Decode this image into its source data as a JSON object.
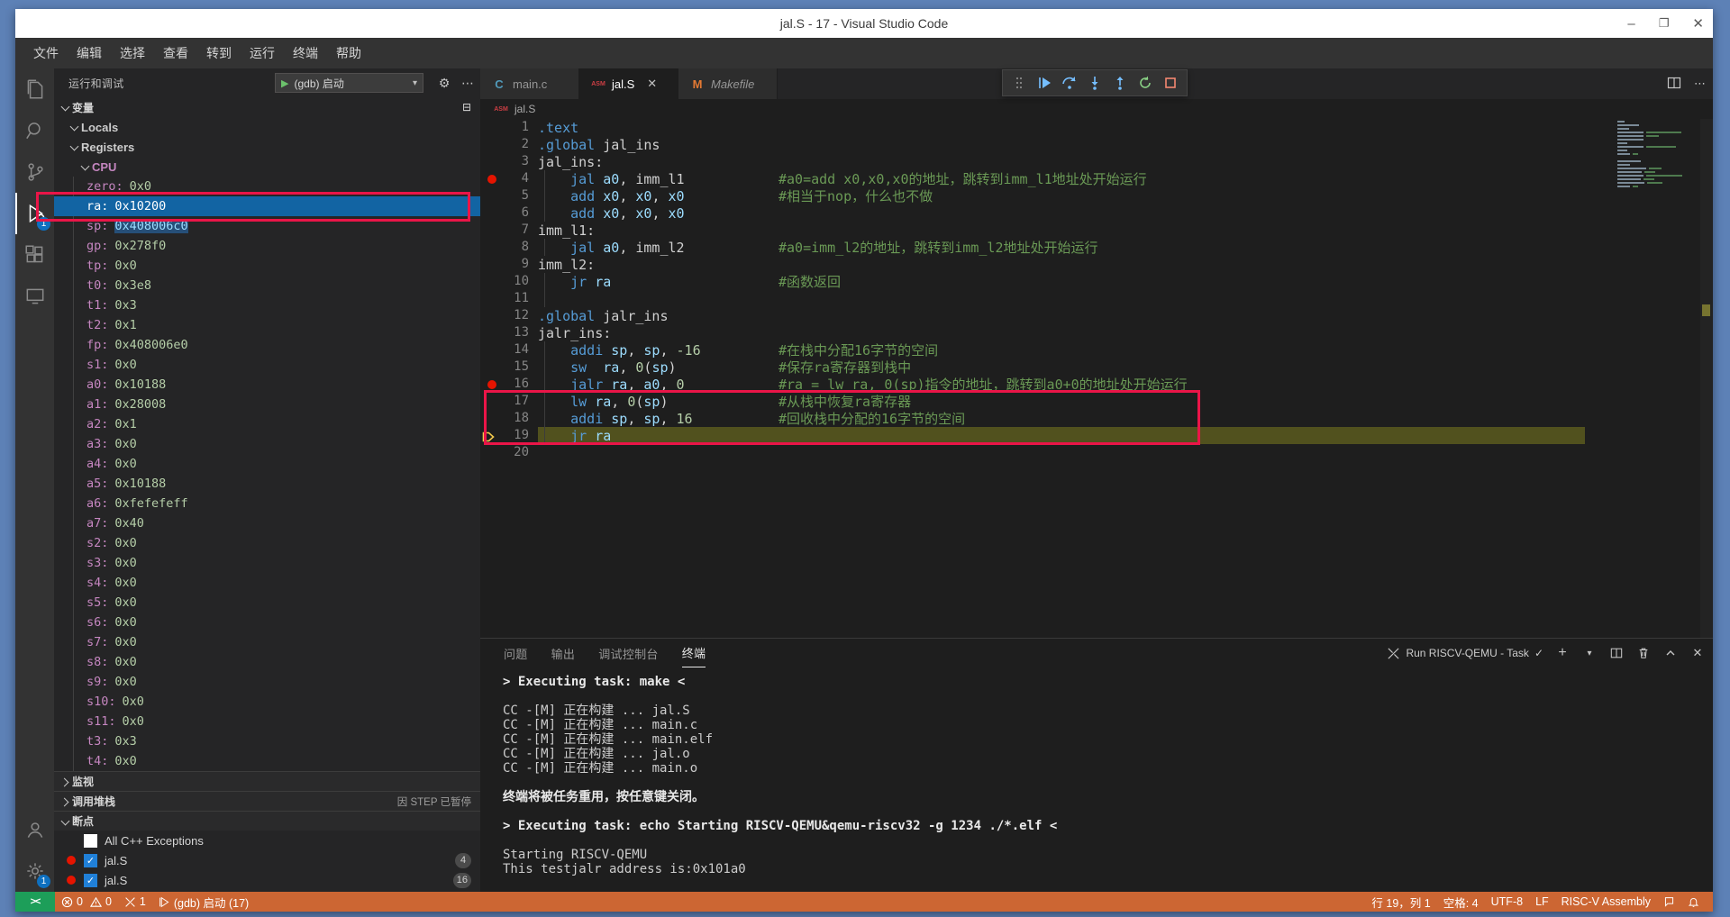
{
  "window": {
    "title": "jal.S - 17 - Visual Studio Code"
  },
  "colors": {
    "desktop": "#5d81b6",
    "status_bar_debugging": "#cc6633",
    "remote_indicator": "#1d9e59",
    "selection_blue": "#1264a3",
    "current_line_highlight": "#51511e",
    "breakpoint_red": "#e51400",
    "annotation_red": "#ea1548",
    "directive_blue": "#569cd6",
    "register_blue": "#9cdcfe",
    "number_green": "#b5cea8",
    "comment_green": "#6a9955",
    "variable_name_pink": "#c586c0",
    "variable_value_green": "#b5cea8"
  },
  "menu": {
    "items": [
      "文件",
      "编辑",
      "选择",
      "查看",
      "转到",
      "运行",
      "终端",
      "帮助"
    ]
  },
  "activity_bar": {
    "icons": [
      "explorer",
      "search",
      "source-control",
      "run-and-debug",
      "extensions",
      "remote-explorer"
    ],
    "debug_badge": "1",
    "bottom_icons": [
      "account",
      "settings-gear"
    ],
    "gear_badge": "1"
  },
  "sidebar": {
    "title": "运行和调试",
    "config_label": "(gdb) 启动",
    "variables_label": "变量",
    "locals_label": "Locals",
    "registers_label": "Registers",
    "cpu_label": "CPU",
    "registers": [
      {
        "name": "zero",
        "value": "0x0"
      },
      {
        "name": "ra",
        "value": "0x10200",
        "selected": true
      },
      {
        "name": "sp",
        "value": "0x408006c0",
        "value_highlight": true
      },
      {
        "name": "gp",
        "value": "0x278f0"
      },
      {
        "name": "tp",
        "value": "0x0"
      },
      {
        "name": "t0",
        "value": "0x3e8"
      },
      {
        "name": "t1",
        "value": "0x3"
      },
      {
        "name": "t2",
        "value": "0x1"
      },
      {
        "name": "fp",
        "value": "0x408006e0"
      },
      {
        "name": "s1",
        "value": "0x0"
      },
      {
        "name": "a0",
        "value": "0x10188"
      },
      {
        "name": "a1",
        "value": "0x28008"
      },
      {
        "name": "a2",
        "value": "0x1"
      },
      {
        "name": "a3",
        "value": "0x0"
      },
      {
        "name": "a4",
        "value": "0x0"
      },
      {
        "name": "a5",
        "value": "0x10188"
      },
      {
        "name": "a6",
        "value": "0xfefefeff"
      },
      {
        "name": "a7",
        "value": "0x40"
      },
      {
        "name": "s2",
        "value": "0x0"
      },
      {
        "name": "s3",
        "value": "0x0"
      },
      {
        "name": "s4",
        "value": "0x0"
      },
      {
        "name": "s5",
        "value": "0x0"
      },
      {
        "name": "s6",
        "value": "0x0"
      },
      {
        "name": "s7",
        "value": "0x0"
      },
      {
        "name": "s8",
        "value": "0x0"
      },
      {
        "name": "s9",
        "value": "0x0"
      },
      {
        "name": "s10",
        "value": "0x0"
      },
      {
        "name": "s11",
        "value": "0x0"
      },
      {
        "name": "t3",
        "value": "0x3"
      },
      {
        "name": "t4",
        "value": "0x0"
      }
    ],
    "watch_label": "监视",
    "callstack_label": "调用堆栈",
    "callstack_status": "因 STEP 已暂停",
    "breakpoints_label": "断点",
    "breakpoints": [
      {
        "label": "All C++ Exceptions",
        "checked": false,
        "dot": false,
        "badge": ""
      },
      {
        "label": "jal.S",
        "checked": true,
        "dot": true,
        "badge": "4"
      },
      {
        "label": "jal.S",
        "checked": true,
        "dot": true,
        "badge": "16"
      }
    ]
  },
  "editor": {
    "tabs": [
      {
        "label": "main.c",
        "icon": "c",
        "active": false,
        "preview": false,
        "close": false
      },
      {
        "label": "jal.S",
        "icon": "asm",
        "active": true,
        "preview": false,
        "close": true
      },
      {
        "label": "Makefile",
        "icon": "m",
        "active": false,
        "preview": true,
        "close": false
      }
    ],
    "breadcrumb": "jal.S",
    "lines": [
      {
        "num": 1,
        "code": [
          [
            "dir",
            ".text"
          ]
        ],
        "comment": "",
        "bp": false,
        "cur": false,
        "g": false
      },
      {
        "num": 2,
        "code": [
          [
            "dir",
            ".global"
          ],
          [
            "pl",
            " jal_ins"
          ]
        ],
        "comment": "",
        "bp": false,
        "cur": false,
        "g": false
      },
      {
        "num": 3,
        "code": [
          [
            "pl",
            "jal_ins:"
          ]
        ],
        "comment": "",
        "bp": false,
        "cur": false,
        "g": false
      },
      {
        "num": 4,
        "code": [
          [
            "pl",
            "    "
          ],
          [
            "mn",
            "jal"
          ],
          [
            "pl",
            " "
          ],
          [
            "reg",
            "a0"
          ],
          [
            "pl",
            ", "
          ],
          [
            "pl",
            "imm_l1"
          ]
        ],
        "comment": "#a0=add x0,x0,x0的地址，跳转到imm_l1地址处开始运行",
        "bp": true,
        "cur": false,
        "g": true
      },
      {
        "num": 5,
        "code": [
          [
            "pl",
            "    "
          ],
          [
            "mn",
            "add"
          ],
          [
            "pl",
            " "
          ],
          [
            "reg",
            "x0"
          ],
          [
            "pl",
            ", "
          ],
          [
            "reg",
            "x0"
          ],
          [
            "pl",
            ", "
          ],
          [
            "reg",
            "x0"
          ]
        ],
        "comment": "#相当于nop，什么也不做",
        "bp": false,
        "cur": false,
        "g": true
      },
      {
        "num": 6,
        "code": [
          [
            "pl",
            "    "
          ],
          [
            "mn",
            "add"
          ],
          [
            "pl",
            " "
          ],
          [
            "reg",
            "x0"
          ],
          [
            "pl",
            ", "
          ],
          [
            "reg",
            "x0"
          ],
          [
            "pl",
            ", "
          ],
          [
            "reg",
            "x0"
          ]
        ],
        "comment": "",
        "bp": false,
        "cur": false,
        "g": true
      },
      {
        "num": 7,
        "code": [
          [
            "pl",
            "imm_l1:"
          ]
        ],
        "comment": "",
        "bp": false,
        "cur": false,
        "g": false
      },
      {
        "num": 8,
        "code": [
          [
            "pl",
            "    "
          ],
          [
            "mn",
            "jal"
          ],
          [
            "pl",
            " "
          ],
          [
            "reg",
            "a0"
          ],
          [
            "pl",
            ", "
          ],
          [
            "pl",
            "imm_l2"
          ]
        ],
        "comment": "#a0=imm_l2的地址，跳转到imm_l2地址处开始运行",
        "bp": false,
        "cur": false,
        "g": true
      },
      {
        "num": 9,
        "code": [
          [
            "pl",
            "imm_l2:"
          ]
        ],
        "comment": "",
        "bp": false,
        "cur": false,
        "g": false
      },
      {
        "num": 10,
        "code": [
          [
            "pl",
            "    "
          ],
          [
            "mn",
            "jr"
          ],
          [
            "pl",
            " "
          ],
          [
            "reg",
            "ra"
          ]
        ],
        "comment": "#函数返回",
        "bp": false,
        "cur": false,
        "g": true
      },
      {
        "num": 11,
        "code": [],
        "comment": "",
        "bp": false,
        "cur": false,
        "g": true
      },
      {
        "num": 12,
        "code": [
          [
            "dir",
            ".global"
          ],
          [
            "pl",
            " jalr_ins"
          ]
        ],
        "comment": "",
        "bp": false,
        "cur": false,
        "g": false
      },
      {
        "num": 13,
        "code": [
          [
            "pl",
            "jalr_ins:"
          ]
        ],
        "comment": "",
        "bp": false,
        "cur": false,
        "g": false
      },
      {
        "num": 14,
        "code": [
          [
            "pl",
            "    "
          ],
          [
            "mn",
            "addi"
          ],
          [
            "pl",
            " "
          ],
          [
            "reg",
            "sp"
          ],
          [
            "pl",
            ", "
          ],
          [
            "reg",
            "sp"
          ],
          [
            "pl",
            ", "
          ],
          [
            "num",
            "-16"
          ]
        ],
        "comment": "#在栈中分配16字节的空间",
        "bp": false,
        "cur": false,
        "g": true
      },
      {
        "num": 15,
        "code": [
          [
            "pl",
            "    "
          ],
          [
            "mn",
            "sw"
          ],
          [
            "pl",
            "  "
          ],
          [
            "reg",
            "ra"
          ],
          [
            "pl",
            ", "
          ],
          [
            "num",
            "0"
          ],
          [
            "pl",
            "("
          ],
          [
            "reg",
            "sp"
          ],
          [
            "pl",
            ")"
          ]
        ],
        "comment": "#保存ra寄存器到栈中",
        "bp": false,
        "cur": false,
        "g": true
      },
      {
        "num": 16,
        "code": [
          [
            "pl",
            "    "
          ],
          [
            "mn",
            "jalr"
          ],
          [
            "pl",
            " "
          ],
          [
            "reg",
            "ra"
          ],
          [
            "pl",
            ", "
          ],
          [
            "reg",
            "a0"
          ],
          [
            "pl",
            ", "
          ],
          [
            "num",
            "0"
          ]
        ],
        "comment": "#ra = lw ra, 0(sp)指令的地址，跳转到a0+0的地址处开始运行",
        "bp": true,
        "cur": false,
        "g": true
      },
      {
        "num": 17,
        "code": [
          [
            "pl",
            "    "
          ],
          [
            "mn",
            "lw"
          ],
          [
            "pl",
            " "
          ],
          [
            "reg",
            "ra"
          ],
          [
            "pl",
            ", "
          ],
          [
            "num",
            "0"
          ],
          [
            "pl",
            "("
          ],
          [
            "reg",
            "sp"
          ],
          [
            "pl",
            ")"
          ]
        ],
        "comment": "#从栈中恢复ra寄存器",
        "bp": false,
        "cur": false,
        "g": true
      },
      {
        "num": 18,
        "code": [
          [
            "pl",
            "    "
          ],
          [
            "mn",
            "addi"
          ],
          [
            "pl",
            " "
          ],
          [
            "reg",
            "sp"
          ],
          [
            "pl",
            ", "
          ],
          [
            "reg",
            "sp"
          ],
          [
            "pl",
            ", "
          ],
          [
            "num",
            "16"
          ]
        ],
        "comment": "#回收栈中分配的16字节的空间",
        "bp": false,
        "cur": false,
        "g": true
      },
      {
        "num": 19,
        "code": [
          [
            "pl",
            "    "
          ],
          [
            "mn",
            "jr"
          ],
          [
            "pl",
            " "
          ],
          [
            "reg",
            "ra"
          ]
        ],
        "comment": "#函数返回",
        "bp": false,
        "cur": true,
        "g": true
      },
      {
        "num": 20,
        "code": [],
        "comment": "",
        "bp": false,
        "cur": false,
        "g": false
      }
    ]
  },
  "panel": {
    "tabs": [
      {
        "label": "问题",
        "active": false
      },
      {
        "label": "输出",
        "active": false
      },
      {
        "label": "调试控制台",
        "active": false
      },
      {
        "label": "终端",
        "active": true
      }
    ],
    "task_label": "Run RISCV-QEMU - Task",
    "terminal_lines": [
      {
        "text": "> Executing task: make <",
        "bold": true
      },
      {
        "text": "",
        "bold": false
      },
      {
        "text": "CC -[M] 正在构建 ... jal.S",
        "bold": false
      },
      {
        "text": "CC -[M] 正在构建 ... main.c",
        "bold": false
      },
      {
        "text": "CC -[M] 正在构建 ... main.elf",
        "bold": false
      },
      {
        "text": "CC -[M] 正在构建 ... jal.o",
        "bold": false
      },
      {
        "text": "CC -[M] 正在构建 ... main.o",
        "bold": false
      },
      {
        "text": "",
        "bold": false
      },
      {
        "text": "终端将被任务重用，按任意键关闭。",
        "bold": true
      },
      {
        "text": "",
        "bold": false
      },
      {
        "text": "> Executing task: echo Starting RISCV-QEMU&qemu-riscv32 -g 1234 ./*.elf <",
        "bold": true
      },
      {
        "text": "",
        "bold": false
      },
      {
        "text": "Starting RISCV-QEMU",
        "bold": false
      },
      {
        "text": "This testjalr address is:0x101a0",
        "bold": false
      }
    ]
  },
  "status_bar": {
    "errors": "0",
    "warnings": "0",
    "tasks": "1",
    "debug_label": "(gdb) 启动 (17)",
    "line_col": "行 19，列 1",
    "indent": "空格: 4",
    "encoding": "UTF-8",
    "eol": "LF",
    "language": "RISC-V Assembly"
  },
  "window_controls": {
    "minimize": "–",
    "restore": "❐",
    "close": "✕"
  }
}
